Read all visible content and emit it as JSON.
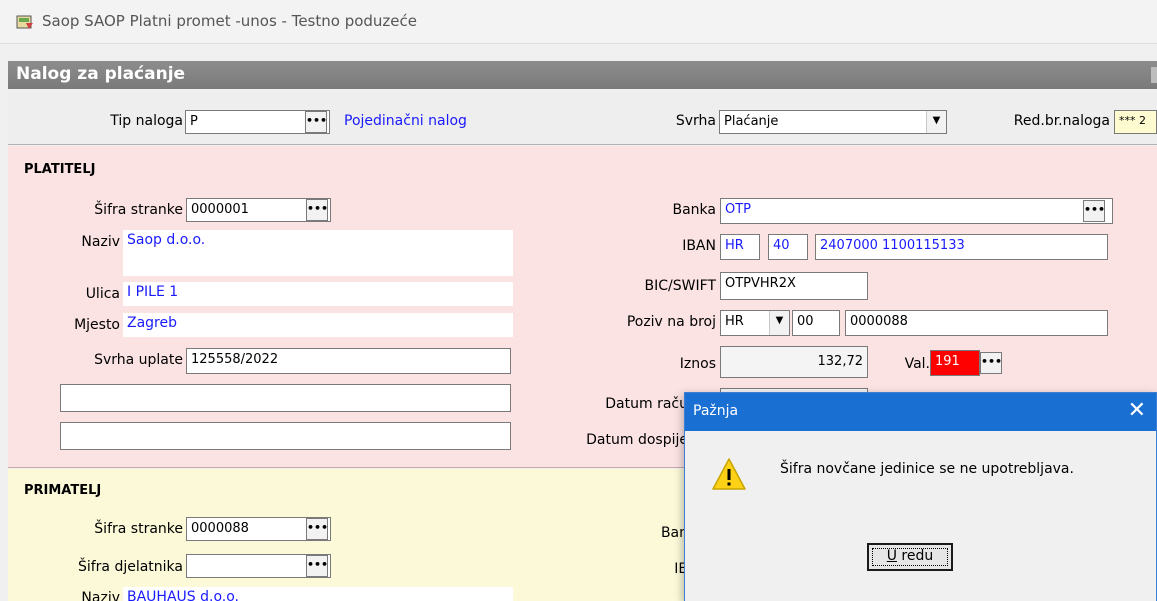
{
  "window": {
    "title": "Saop SAOP Platni promet -unos - Testno poduzeće"
  },
  "form": {
    "header": "Nalog za plaćanje"
  },
  "tip": {
    "tip_label": "Tip naloga",
    "tip_value": "P",
    "tip_desc": "Pojedinačni nalog",
    "svrha_label": "Svrha",
    "svrha_value": "Plaćanje",
    "redbr_label": "Red.br.naloga",
    "redbr_value": "*** 2"
  },
  "platitelj": {
    "title": "PLATITELJ",
    "sifra_label": "Šifra stranke",
    "sifra_value": "0000001",
    "naziv_label": "Naziv",
    "naziv_value": "Saop d.o.o.",
    "ulica_label": "Ulica",
    "ulica_value": "I PILE 1",
    "mjesto_label": "Mjesto",
    "mjesto_value": "Zagreb",
    "svrha_uplate_label": "Svrha uplate",
    "svrha_uplate_value": "125558/2022",
    "extra1_value": "",
    "extra2_value": "",
    "banka_label": "Banka",
    "banka_value": "OTP",
    "iban_label": "IBAN",
    "iban_country": "HR",
    "iban_check": "40",
    "iban_number": "2407000 1100115133",
    "bic_label": "BIC/SWIFT",
    "bic_value": "OTPVHR2X",
    "poziv_label": "Poziv na broj",
    "poziv_country": "HR",
    "poziv_model": "00",
    "poziv_number": "0000088",
    "iznos_label": "Iznos",
    "iznos_value": "132,72",
    "val_label": "Val.",
    "val_value": "191",
    "datum_racuna_label": "Datum raču",
    "datum_dospijeca_label": "Datum dospije"
  },
  "primatelj": {
    "title": "PRIMATELJ",
    "sifra_label": "Šifra stranke",
    "sifra_value": "0000088",
    "djelatnik_label": "Šifra djelatnika",
    "djelatnik_value": "",
    "naziv_label": "Naziv",
    "naziv_value": "BAUHAUS d.o.o.",
    "banka_label": "Ban",
    "iban_label": "IB"
  },
  "dialog": {
    "title": "Pažnja",
    "message": "Šifra novčane jedinice se ne upotrebljava.",
    "ok_accel": "U",
    "ok_rest": " redu"
  },
  "colors": {
    "platitelj_bg": "#fbe3e3",
    "primatelj_bg": "#fbf9d8",
    "dialog_title": "#1a6fd3",
    "currency_error": "#ff0000",
    "link_text": "#1a1aff"
  }
}
